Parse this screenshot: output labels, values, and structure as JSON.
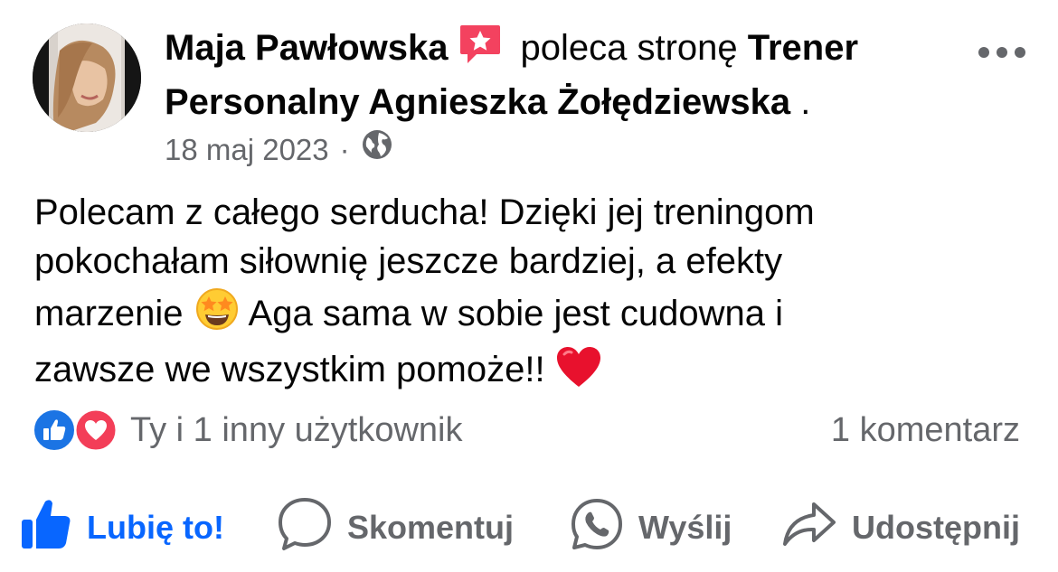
{
  "post": {
    "author": "Maja Pawłowska",
    "action_text": "poleca stronę",
    "page_name": "Trener Personalny Agnieszka Żołędziewska",
    "page_name_suffix": ".",
    "date": "18 maj 2023",
    "meta_separator": "·",
    "audience_icon": "globe-icon",
    "text_lines": {
      "line1": "Polecam z całego serducha! Dzięki jej treningom",
      "line2": "pokochałam siłownię jeszcze bardziej, a efekty",
      "line3_a": "marzenie",
      "line3_b": "Aga sama w sobie jest cudowna i",
      "line4": "zawsze we wszystkim pomoże!!"
    },
    "emojis": [
      "star-struck-emoji",
      "red-heart-emoji"
    ]
  },
  "reactions": {
    "icons": [
      "like-reaction-icon",
      "love-reaction-icon"
    ],
    "summary": "Ty i 1 inny użytkownik",
    "comments": "1 komentarz"
  },
  "actions": {
    "like": "Lubię to!",
    "comment": "Skomentuj",
    "send": "Wyślij",
    "share": "Udostępnij"
  },
  "colors": {
    "accent_blue": "#0866ff",
    "secondary_text": "#65676b",
    "love_red": "#f33e58",
    "recommend_badge": "#f3425f"
  }
}
